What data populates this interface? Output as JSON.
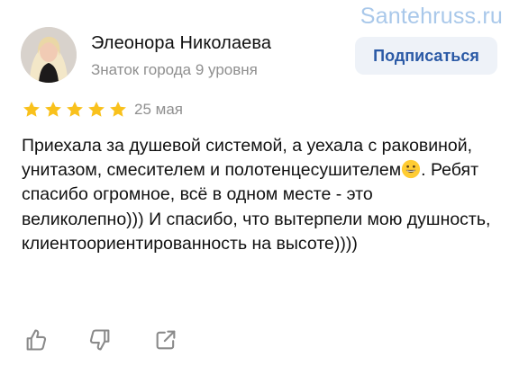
{
  "watermark": "Santehruss.ru",
  "author": {
    "name": "Элеонора Николаева",
    "status": "Знаток города 9 уровня",
    "subscribe_label": "Подписаться"
  },
  "review": {
    "rating": 5,
    "rating_max": 5,
    "date": "25 мая",
    "text_part1": "Приехала за душевой системой, а уехала с раковиной, унитазом, смесителем и полотенцесушителем",
    "text_part2": ". Ребят спасибо огромное, всё в одном месте - это великолепно))) И спасибо, что вытерпели мою душность, клиентоориентированность на высоте))))",
    "emoji": "grinning-face-emoji"
  },
  "actions": {
    "like_icon": "thumbs-up-icon",
    "dislike_icon": "thumbs-down-icon",
    "share_icon": "share-icon"
  },
  "colors": {
    "star": "#f9c11c",
    "subscribe_bg": "#eef2f8",
    "subscribe_text": "#2b5aa6",
    "watermark": "#a9c8ea",
    "muted_text": "#8f8f8f"
  }
}
